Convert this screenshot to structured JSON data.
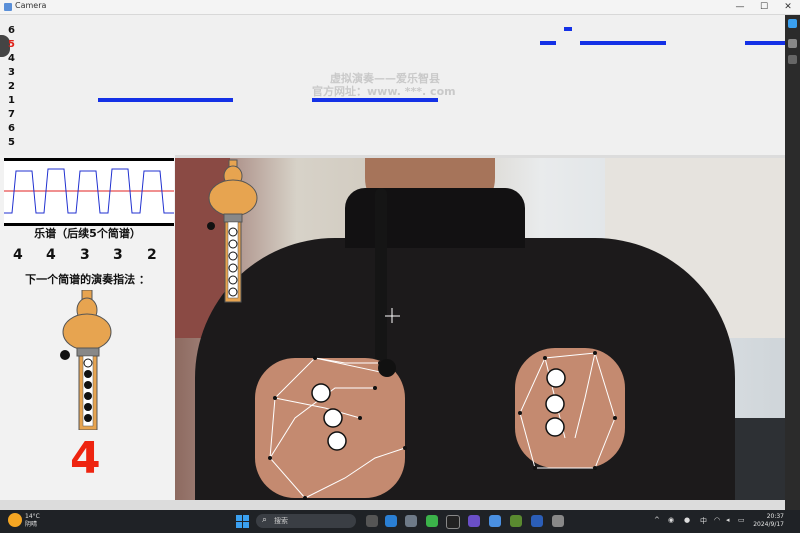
{
  "window": {
    "title": "Camera",
    "minimize": "—",
    "maximize": "☐",
    "close": "✕"
  },
  "piano_roll": {
    "pitches": [
      "6",
      "5",
      "4",
      "3",
      "2",
      "1",
      "7",
      "6",
      "5"
    ],
    "active_pitch_index": 1,
    "watermark_line1": "虚拟演奏——爱乐智县",
    "watermark_line2": "官方网址：www. ***. com",
    "note_color": "#1431e6"
  },
  "score": {
    "title": "乐谱（后续5个简谱）",
    "notes": [
      "4",
      "4",
      "3",
      "3",
      "2"
    ],
    "fingering_title": "下一个简谱的演奏指法 ：",
    "next_note": "4",
    "next_note_color": "#ee2410"
  },
  "taskbar": {
    "weather_temp": "14°C",
    "weather_desc": "阴晴",
    "search_placeholder": "搜索",
    "ime": "中",
    "time": "20:37",
    "date": "2024/9/17"
  }
}
